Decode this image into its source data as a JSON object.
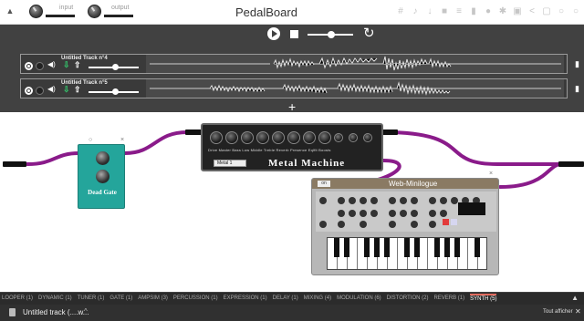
{
  "header": {
    "title": "PedalBoard",
    "input_label": "input",
    "output_label": "output"
  },
  "tracks": [
    {
      "name": "Untitled Track n°4"
    },
    {
      "name": "Untitled Track n°5"
    }
  ],
  "plugins": {
    "pedal_name": "Dead Gate",
    "amp_name": "Metal Machine",
    "amp_preset": "Metal 1",
    "amp_knob_labels": "Drive  Master  Bass  Low  Middle  Treble  Reverb  Presence  Eqlfit  Boosts",
    "synth_title": "Web-Minilogue"
  },
  "categories": [
    {
      "label": "LOOPER (1)"
    },
    {
      "label": "DYNAMIC (1)"
    },
    {
      "label": "TUNER (1)"
    },
    {
      "label": "GATE (1)"
    },
    {
      "label": "AMPSIM (3)"
    },
    {
      "label": "PERCUSSION (1)"
    },
    {
      "label": "EXPRESSION (1)"
    },
    {
      "label": "DELAY (1)"
    },
    {
      "label": "MIXING (4)"
    },
    {
      "label": "MODULATION (6)"
    },
    {
      "label": "DISTORTION (2)"
    },
    {
      "label": "REVERB (1)"
    },
    {
      "label": "SYNTH (5)",
      "active": true
    }
  ],
  "download": {
    "file_name": "Untitled track (....w...",
    "show_all": "Tout afficher"
  }
}
